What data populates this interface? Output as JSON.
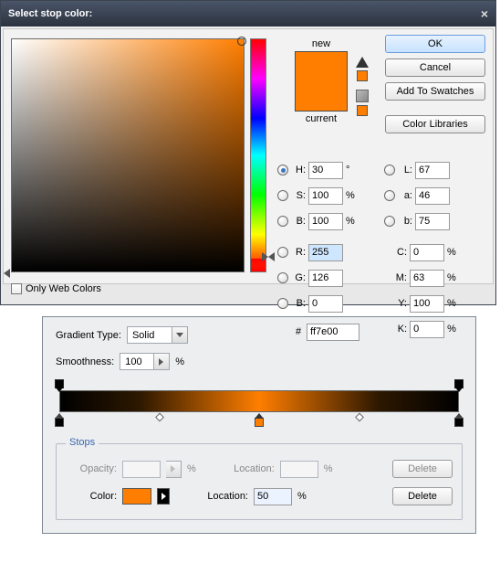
{
  "dialog": {
    "title": "Select stop color:",
    "close": "×",
    "new_label": "new",
    "current_label": "current",
    "buttons": {
      "ok": "OK",
      "cancel": "Cancel",
      "add_swatches": "Add To Swatches",
      "color_libraries": "Color Libraries"
    },
    "hsb": {
      "H": "30",
      "Hu": "°",
      "S": "100",
      "Su": "%",
      "B": "100",
      "Bu": "%"
    },
    "rgb": {
      "R": "255",
      "G": "126",
      "B": "0"
    },
    "lab": {
      "L": "67",
      "a": "46",
      "b": "75"
    },
    "cmyk": {
      "C": "0",
      "M": "63",
      "Y": "100",
      "K": "0"
    },
    "labels": {
      "H": "H:",
      "S": "S:",
      "Bv": "B:",
      "R": "R:",
      "G": "G:",
      "B": "B:",
      "L": "L:",
      "a": "a:",
      "b": "b:",
      "C": "C:",
      "M": "M:",
      "Y": "Y:",
      "K": "K:",
      "pct": "%",
      "hash": "#"
    },
    "hex": "ff7e00",
    "only_web": "Only Web Colors",
    "swatch_new": "#ff7e00",
    "swatch_current": "#ff7e00"
  },
  "gradient": {
    "type_label": "Gradient Type:",
    "type_value": "Solid",
    "smooth_label": "Smoothness:",
    "smooth_value": "100",
    "smooth_unit": "%",
    "stops_title": "Stops",
    "opacity_label": "Opacity:",
    "opacity_value": "",
    "opacity_unit": "%",
    "loc1_label": "Location:",
    "loc1_value": "",
    "loc1_unit": "%",
    "delete1": "Delete",
    "color_label": "Color:",
    "loc2_label": "Location:",
    "loc2_value": "50",
    "loc2_unit": "%",
    "delete2": "Delete",
    "stop_color": "#ff7e00",
    "opacity_stops": [
      0,
      100
    ],
    "color_stops": [
      {
        "pos": 0,
        "color": "#000000"
      },
      {
        "pos": 50,
        "color": "#ff7e00"
      },
      {
        "pos": 100,
        "color": "#000000"
      }
    ],
    "midpoints": [
      25,
      75
    ]
  }
}
